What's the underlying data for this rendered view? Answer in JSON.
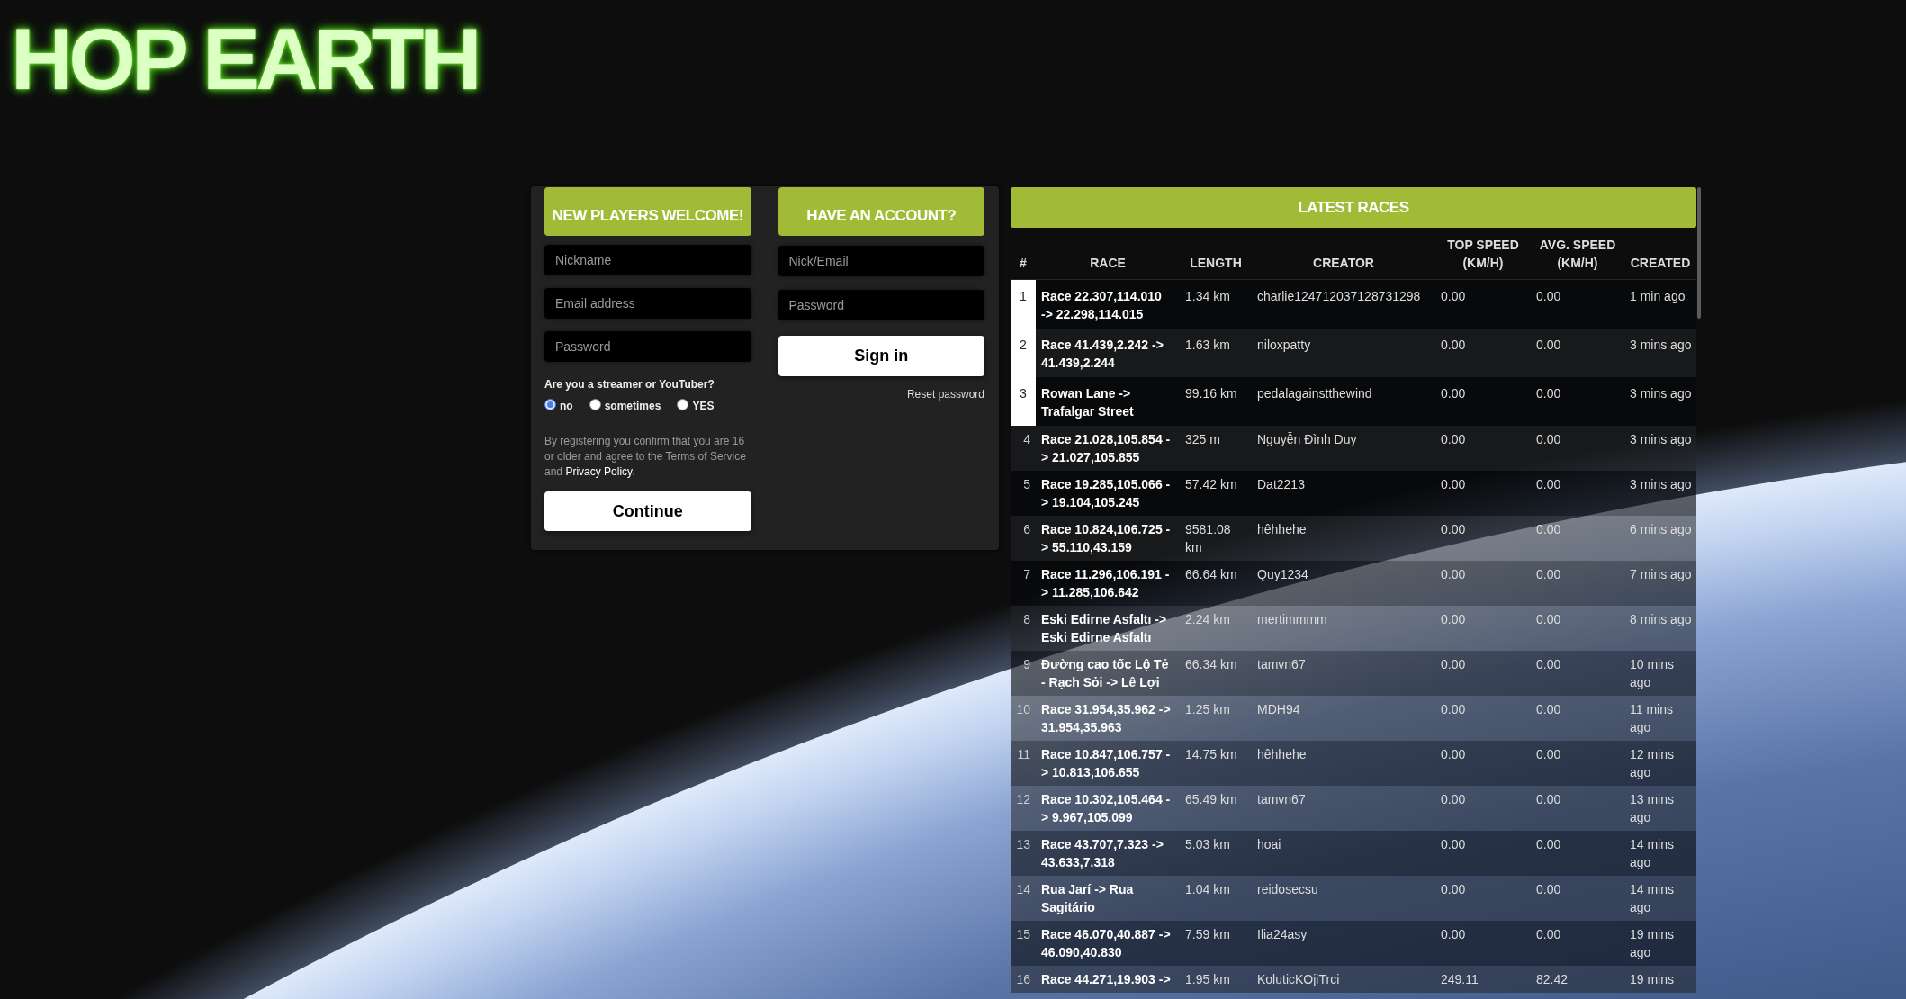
{
  "logo": {
    "text": "HOP EARTH"
  },
  "signup": {
    "title": "NEW PLAYERS WELCOME!",
    "fields": [
      {
        "placeholder": "Nickname"
      },
      {
        "placeholder": "Email address"
      },
      {
        "placeholder": "Password"
      }
    ],
    "question": "Are you a streamer or YouTuber?",
    "options": [
      {
        "label": "no",
        "selected": true
      },
      {
        "label": "sometimes",
        "selected": false
      },
      {
        "label": "YES",
        "selected": false
      }
    ],
    "disclaimer": {
      "text": "By registering you confirm that you are 16 or older and agree to the Terms of Service and",
      "link": "Privacy Policy",
      "end": "."
    },
    "button": "Continue"
  },
  "signin": {
    "title": "HAVE AN ACCOUNT?",
    "fields": [
      {
        "placeholder": "Nick/Email"
      },
      {
        "placeholder": "Password"
      }
    ],
    "button": "Sign in",
    "link": "Reset password"
  },
  "latest_races": {
    "title": "LATEST RACES",
    "columns": [
      "#",
      "RACE",
      "LENGTH",
      "CREATOR",
      "TOP SPEED (KM/H)",
      "AVG. SPEED (KM/H)",
      "CREATED"
    ],
    "rows": [
      {
        "rank": "1",
        "highlighted": true,
        "race": "Race 22.307,114.010 -> 22.298,114.015",
        "length": "1.34 km",
        "creator": "charlie124712037128731298",
        "top_speed": "0.00",
        "avg_speed": "0.00",
        "created": "1 min ago"
      },
      {
        "rank": "2",
        "highlighted": true,
        "race": "Race 41.439,2.242 -> 41.439,2.244",
        "length": "1.63 km",
        "creator": "niloxpatty",
        "top_speed": "0.00",
        "avg_speed": "0.00",
        "created": "3 mins ago"
      },
      {
        "rank": "3",
        "highlighted": true,
        "race": "Rowan Lane -> Trafalgar Street",
        "length": "99.16 km",
        "creator": "pedalagainstthewind",
        "top_speed": "0.00",
        "avg_speed": "0.00",
        "created": "3 mins ago"
      },
      {
        "rank": "4",
        "highlighted": false,
        "race": "Race 21.028,105.854 -> 21.027,105.855",
        "length": "325 m",
        "creator": "Nguyễn Đình Duy",
        "top_speed": "0.00",
        "avg_speed": "0.00",
        "created": "3 mins ago"
      },
      {
        "rank": "5",
        "highlighted": false,
        "race": "Race 19.285,105.066 -> 19.104,105.245",
        "length": "57.42 km",
        "creator": "Dat2213",
        "top_speed": "0.00",
        "avg_speed": "0.00",
        "created": "3 mins ago"
      },
      {
        "rank": "6",
        "highlighted": false,
        "race": "Race 10.824,106.725 -> 55.110,43.159",
        "length": "9581.08 km",
        "creator": "hêhhehe",
        "top_speed": "0.00",
        "avg_speed": "0.00",
        "created": "6 mins ago"
      },
      {
        "rank": "7",
        "highlighted": false,
        "race": "Race 11.296,106.191 -> 11.285,106.642",
        "length": "66.64 km",
        "creator": "Quy1234",
        "top_speed": "0.00",
        "avg_speed": "0.00",
        "created": "7 mins ago"
      },
      {
        "rank": "8",
        "highlighted": false,
        "race": "Eski Edirne Asfaltı -> Eski Edirne Asfaltı",
        "length": "2.24 km",
        "creator": "mertimmmm",
        "top_speed": "0.00",
        "avg_speed": "0.00",
        "created": "8 mins ago"
      },
      {
        "rank": "9",
        "highlighted": false,
        "race": "Đường cao tốc Lộ Tẻ - Rạch Sỏi -> Lê Lợi",
        "length": "66.34 km",
        "creator": "tamvn67",
        "top_speed": "0.00",
        "avg_speed": "0.00",
        "created": "10 mins ago"
      },
      {
        "rank": "10",
        "highlighted": false,
        "race": "Race 31.954,35.962 -> 31.954,35.963",
        "length": "1.25 km",
        "creator": "MDH94",
        "top_speed": "0.00",
        "avg_speed": "0.00",
        "created": "11 mins ago"
      },
      {
        "rank": "11",
        "highlighted": false,
        "race": "Race 10.847,106.757 -> 10.813,106.655",
        "length": "14.75 km",
        "creator": "hêhhehe",
        "top_speed": "0.00",
        "avg_speed": "0.00",
        "created": "12 mins ago"
      },
      {
        "rank": "12",
        "highlighted": false,
        "race": "Race 10.302,105.464 -> 9.967,105.099",
        "length": "65.49 km",
        "creator": "tamvn67",
        "top_speed": "0.00",
        "avg_speed": "0.00",
        "created": "13 mins ago"
      },
      {
        "rank": "13",
        "highlighted": false,
        "race": "Race 43.707,7.323 -> 43.633,7.318",
        "length": "5.03 km",
        "creator": "hoai",
        "top_speed": "0.00",
        "avg_speed": "0.00",
        "created": "14 mins ago"
      },
      {
        "rank": "14",
        "highlighted": false,
        "race": "Rua Jarí -> Rua Sagitário",
        "length": "1.04 km",
        "creator": "reidosecsu",
        "top_speed": "0.00",
        "avg_speed": "0.00",
        "created": "14 mins ago"
      },
      {
        "rank": "15",
        "highlighted": false,
        "race": "Race 46.070,40.887 -> 46.090,40.830",
        "length": "7.59 km",
        "creator": "Ilia24asy",
        "top_speed": "0.00",
        "avg_speed": "0.00",
        "created": "19 mins ago"
      },
      {
        "rank": "16",
        "highlighted": false,
        "race": "Race 44.271,19.903 ->",
        "length": "1.95 km",
        "creator": "KoluticKOjiTrci",
        "top_speed": "249.11",
        "avg_speed": "82.42",
        "created": "19 mins"
      }
    ]
  }
}
